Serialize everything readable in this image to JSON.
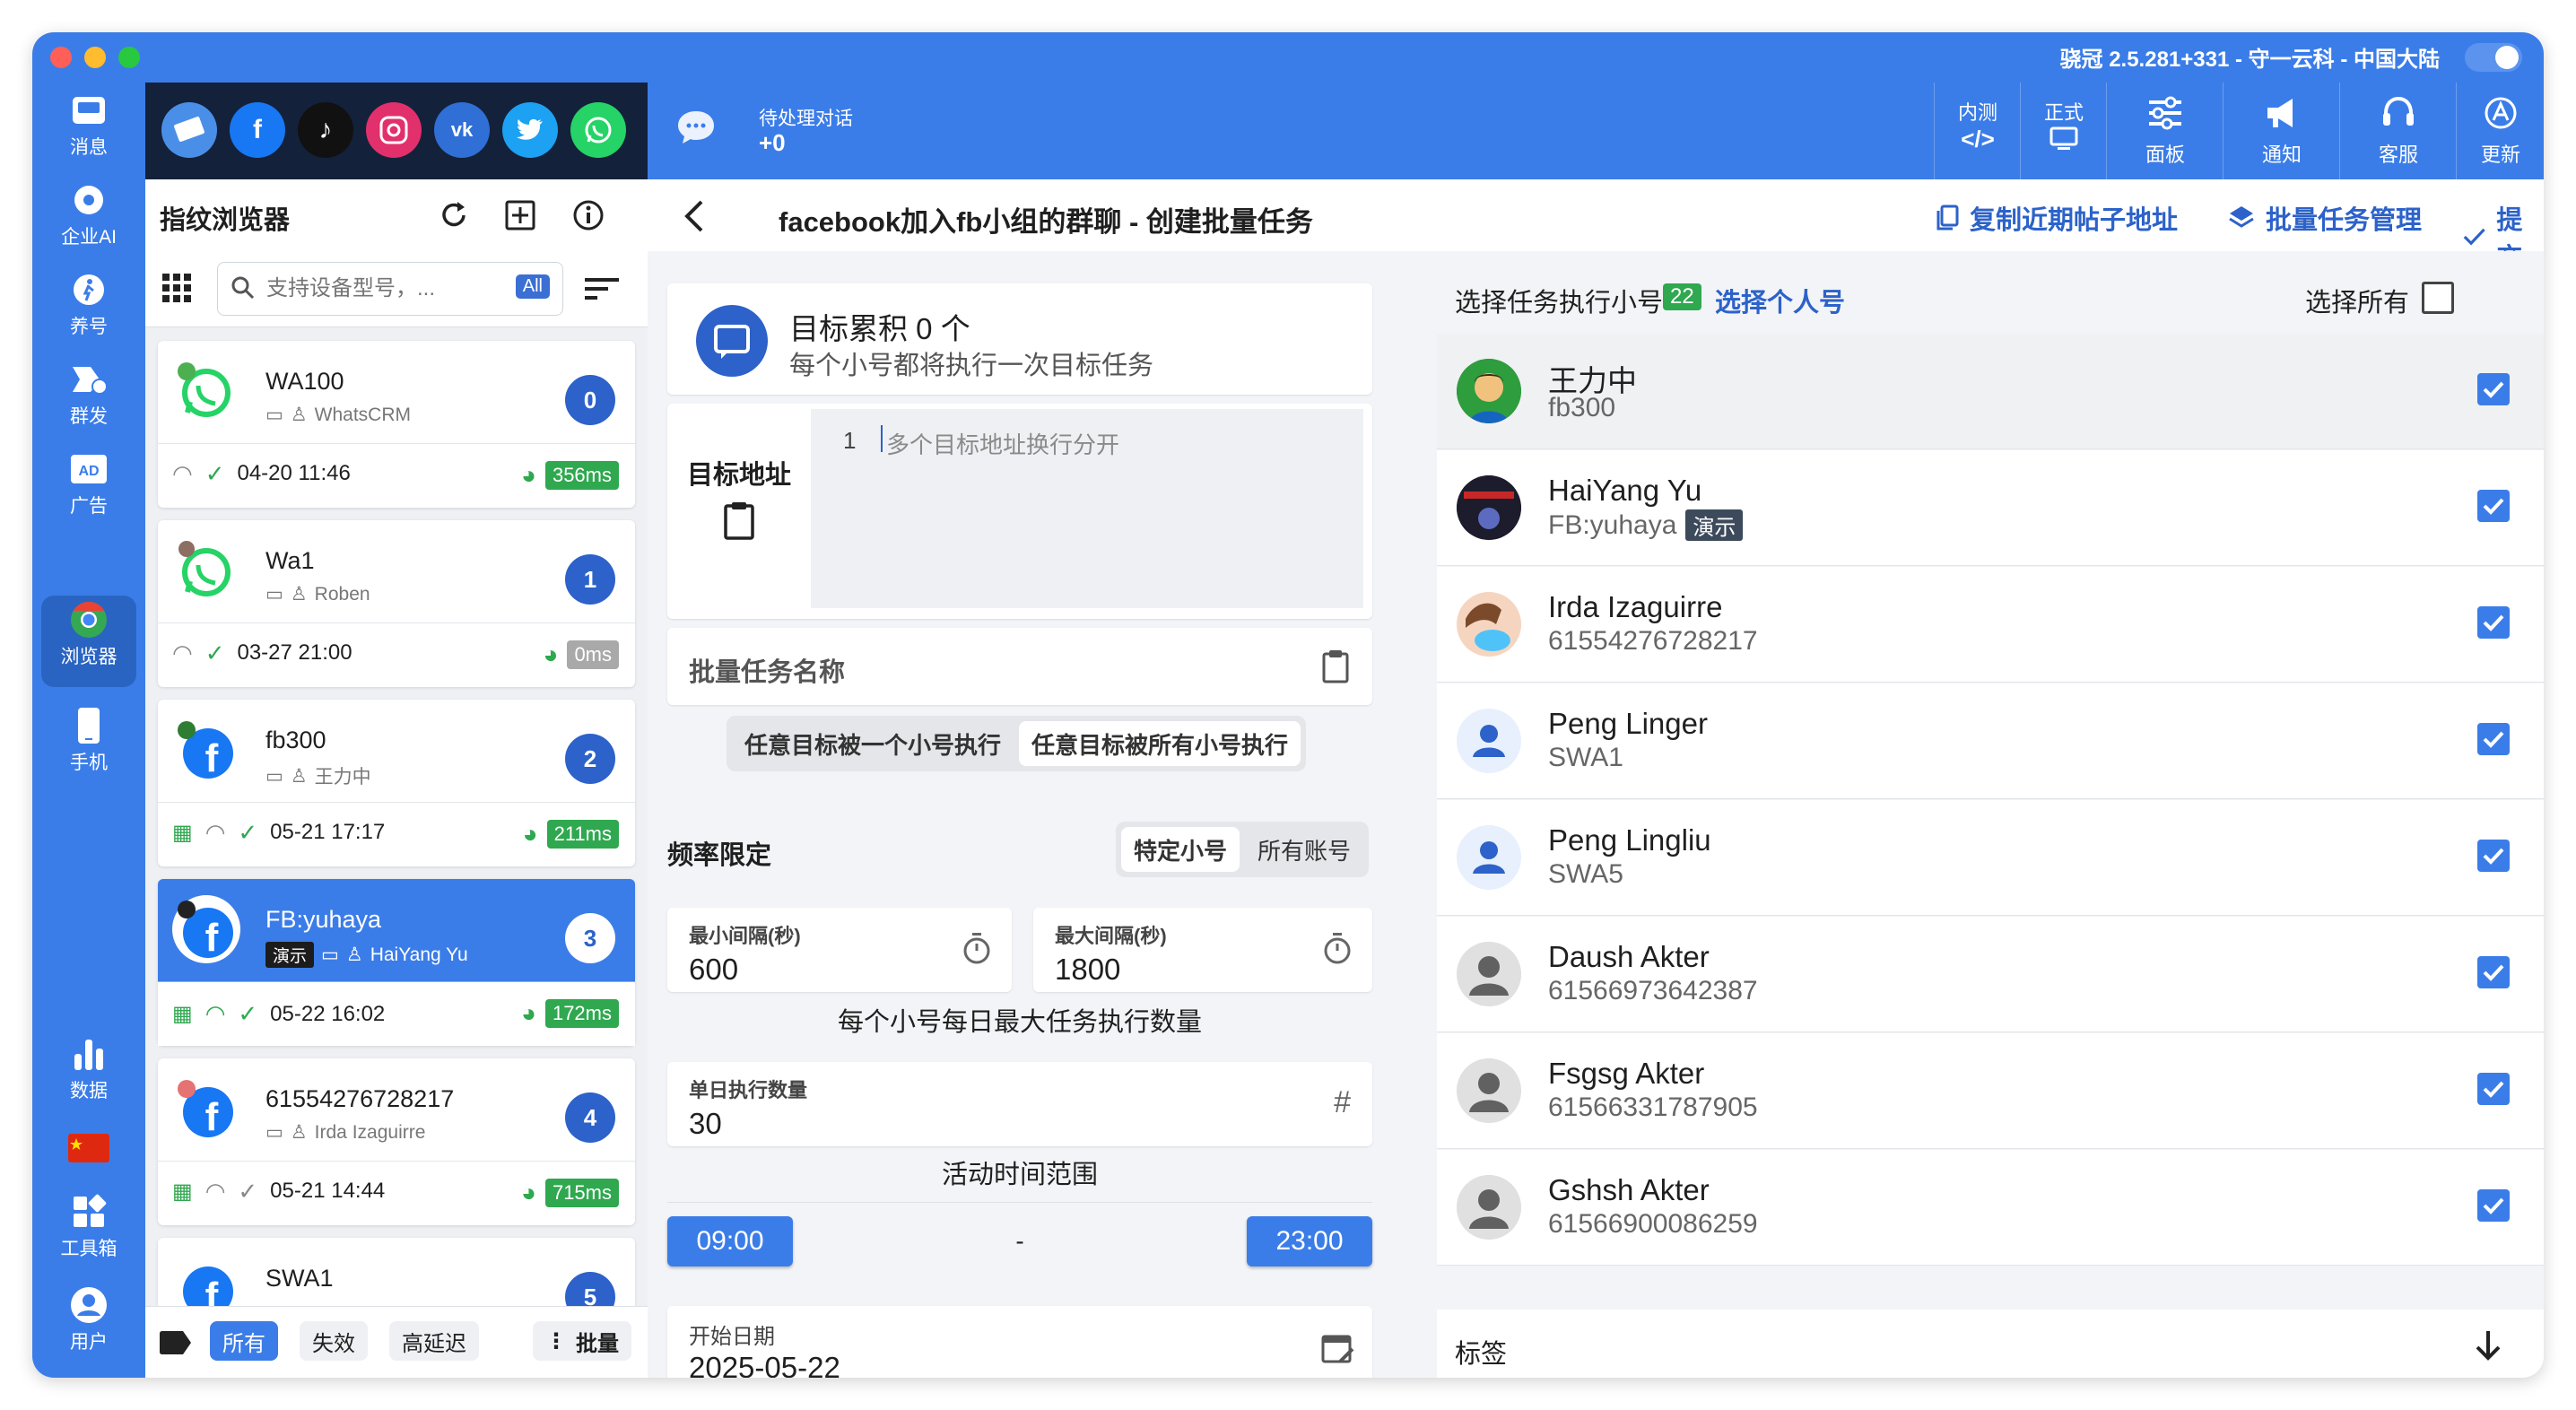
{
  "titlebar": {
    "title": "骁冠 2.5.281+331 - 守一云科 - 中国大陆"
  },
  "sidebar": {
    "items": [
      {
        "label": "消息",
        "icon": "inbox-icon"
      },
      {
        "label": "企业AI",
        "icon": "ai-gear-icon"
      },
      {
        "label": "养号",
        "icon": "walk-icon"
      },
      {
        "label": "群发",
        "icon": "broadcast-icon"
      },
      {
        "label": "广告",
        "icon": "ad-icon"
      },
      {
        "label": "浏览器",
        "icon": "chrome-icon"
      },
      {
        "label": "手机",
        "icon": "phone-icon"
      },
      {
        "label": "数据",
        "icon": "bar-chart-icon"
      },
      {
        "label": "工具箱",
        "icon": "widgets-icon"
      },
      {
        "label": "用户",
        "icon": "user-icon"
      }
    ]
  },
  "topbar": {
    "pending_label": "待处理对话",
    "pending_count": "+0",
    "buttons": [
      {
        "top": "内测",
        "label": "</>",
        "icon": "code-icon"
      },
      {
        "top": "正式",
        "label": "",
        "icon": "release-icon"
      },
      {
        "label": "面板",
        "icon": "sliders-icon"
      },
      {
        "label": "通知",
        "icon": "megaphone-icon"
      },
      {
        "label": "客服",
        "icon": "headset-icon"
      },
      {
        "label": "更新",
        "icon": "update-icon"
      }
    ]
  },
  "left_panel": {
    "title": "指纹浏览器",
    "search_placeholder": "支持设备型号，...",
    "all_badge": "All",
    "cards": [
      {
        "name": "WA100",
        "sub": "WhatsCRM",
        "index": "0",
        "time": "04-20 11:46",
        "latency": "356ms",
        "type": "whatsapp"
      },
      {
        "name": "Wa1",
        "sub": "Roben",
        "index": "1",
        "time": "03-27 21:00",
        "latency": "0ms",
        "type": "whatsapp"
      },
      {
        "name": "fb300",
        "sub": "王力中",
        "index": "2",
        "time": "05-21 17:17",
        "latency": "211ms",
        "type": "facebook"
      },
      {
        "name": "FB:yuhaya",
        "sub": "HaiYang Yu",
        "tag": "演示",
        "index": "3",
        "time": "05-22 16:02",
        "latency": "172ms",
        "type": "facebook"
      },
      {
        "name": "61554276728217",
        "sub": "Irda Izaguirre",
        "index": "4",
        "time": "05-21 14:44",
        "latency": "715ms",
        "type": "facebook"
      },
      {
        "name": "SWA1",
        "index": "5",
        "type": "facebook"
      }
    ],
    "footer": {
      "all": "所有",
      "invalid": "失效",
      "high_latency": "高延迟",
      "batch": "批量"
    }
  },
  "main": {
    "title": "facebook加入fb小组的群聊 - 创建批量任务",
    "copy_link": "复制近期帖子地址",
    "manage_link": "批量任务管理",
    "submit_link": "提交",
    "target_count": "目标累积 0 个",
    "target_hint": "每个小号都将执行一次目标任务",
    "target_label": "目标地址",
    "line_no": "1",
    "target_placeholder": "多个目标地址换行分开",
    "task_name_placeholder": "批量任务名称",
    "mode_a": "任意目标被一个小号执行",
    "mode_b": "任意目标被所有小号执行",
    "freq_label": "频率限定",
    "freq_a": "特定小号",
    "freq_b": "所有账号",
    "min_label": "最小间隔(秒)",
    "min_value": "600",
    "max_label": "最大间隔(秒)",
    "max_value": "1800",
    "daily_title": "每个小号每日最大任务执行数量",
    "daily_label": "单日执行数量",
    "daily_value": "30",
    "active_title": "活动时间范围",
    "start_time": "09:00",
    "dash": "-",
    "end_time": "23:00",
    "start_date_label": "开始日期",
    "start_date": "2025-05-22"
  },
  "right_panel": {
    "header": "选择任务执行小号",
    "count": "22",
    "personal_link": "选择个人号",
    "select_all": "选择所有",
    "accounts": [
      {
        "name": "王力中",
        "sub": "fb300"
      },
      {
        "name": "HaiYang Yu",
        "sub": "FB:yuhaya",
        "tag": "演示"
      },
      {
        "name": "Irda Izaguirre",
        "sub": "61554276728217"
      },
      {
        "name": "Peng Linger",
        "sub": "SWA1"
      },
      {
        "name": "Peng Lingliu",
        "sub": "SWA5"
      },
      {
        "name": "Daush Akter",
        "sub": "61566973642387"
      },
      {
        "name": "Fsgsg Akter",
        "sub": "61566331787905"
      },
      {
        "name": "Gshsh Akter",
        "sub": "61566900086259"
      }
    ],
    "tags_label": "标签"
  },
  "colors": {
    "primary": "#3b7de8",
    "dark_header": "#14213a",
    "latency_green": "#2fa84f",
    "count_badge": "#2fa84f"
  }
}
